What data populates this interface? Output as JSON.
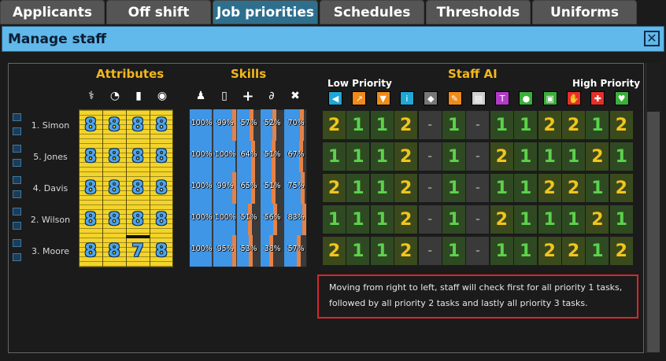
{
  "tabs": [
    {
      "label": "Applicants",
      "active": false
    },
    {
      "label": "Off shift",
      "active": false
    },
    {
      "label": "Job priorities",
      "active": true
    },
    {
      "label": "Schedules",
      "active": false
    },
    {
      "label": "Thresholds",
      "active": false
    },
    {
      "label": "Uniforms",
      "active": false
    }
  ],
  "window": {
    "title": "Manage staff",
    "close": "✕"
  },
  "sections": {
    "attributes": "Attributes",
    "skills": "Skills",
    "staff_ai": "Staff AI"
  },
  "priority_labels": {
    "low": "Low Priority",
    "high": "High Priority"
  },
  "attribute_icons": [
    "bone-icon",
    "gauge-icon",
    "clipboard-icon",
    "eye-icon"
  ],
  "skill_icons": [
    "person-icon",
    "trash-icon",
    "cross-icon",
    "wrench-pipe-icon",
    "tools-icon"
  ],
  "ai_icons": [
    {
      "name": "megaphone-icon",
      "color": "#1fa7d6"
    },
    {
      "name": "wrench-orange-icon",
      "color": "#f08a1a"
    },
    {
      "name": "shield-orange-icon",
      "color": "#f08a1a"
    },
    {
      "name": "info-icon",
      "color": "#1fa7d6"
    },
    {
      "name": "eraser-icon",
      "color": "#777777"
    },
    {
      "name": "sweep-icon",
      "color": "#f08a1a"
    },
    {
      "name": "document-icon",
      "color": "#cfcfcf"
    },
    {
      "name": "tool-purple-icon",
      "color": "#b13bc6"
    },
    {
      "name": "pills-icon",
      "color": "#3cae3c"
    },
    {
      "name": "device-green-icon",
      "color": "#3cae3c"
    },
    {
      "name": "hand-red-icon",
      "color": "#e53028"
    },
    {
      "name": "syringe-red-icon",
      "color": "#e53028"
    },
    {
      "name": "heart-green-icon",
      "color": "#3cae3c"
    }
  ],
  "staff": [
    {
      "name": "1. Simon",
      "attributes": [
        "8",
        "8",
        "8",
        "8"
      ],
      "skills": [
        {
          "text": "100%",
          "value": 1.0
        },
        {
          "text": "99%",
          "value": 0.99
        },
        {
          "text": "57%",
          "value": 0.57
        },
        {
          "text": "52%",
          "value": 0.52
        },
        {
          "text": "70%",
          "value": 0.7
        }
      ],
      "ai": [
        "2",
        "1",
        "1",
        "2",
        "-",
        "1",
        "-",
        "1",
        "1",
        "2",
        "2",
        "1",
        "2"
      ]
    },
    {
      "name": "5. Jones",
      "attributes": [
        "8",
        "8",
        "8",
        "8"
      ],
      "skills": [
        {
          "text": "100%",
          "value": 1.0
        },
        {
          "text": "100%",
          "value": 1.0
        },
        {
          "text": "64%",
          "value": 0.64
        },
        {
          "text": "51%",
          "value": 0.51
        },
        {
          "text": "67%",
          "value": 0.67
        }
      ],
      "ai": [
        "1",
        "1",
        "1",
        "2",
        "-",
        "1",
        "-",
        "2",
        "1",
        "1",
        "1",
        "2",
        "1"
      ]
    },
    {
      "name": "4. Davis",
      "attributes": [
        "8",
        "8",
        "8",
        "8"
      ],
      "skills": [
        {
          "text": "100%",
          "value": 1.0
        },
        {
          "text": "99%",
          "value": 0.99
        },
        {
          "text": "65%",
          "value": 0.65
        },
        {
          "text": "51%",
          "value": 0.51
        },
        {
          "text": "75%",
          "value": 0.75
        }
      ],
      "ai": [
        "2",
        "1",
        "1",
        "2",
        "-",
        "1",
        "-",
        "1",
        "1",
        "2",
        "2",
        "1",
        "2"
      ]
    },
    {
      "name": "2. Wilson",
      "attributes": [
        "8",
        "8",
        "8",
        "8"
      ],
      "skills": [
        {
          "text": "100%",
          "value": 1.0
        },
        {
          "text": "100%",
          "value": 1.0
        },
        {
          "text": "51%",
          "value": 0.51
        },
        {
          "text": "56%",
          "value": 0.56
        },
        {
          "text": "83%",
          "value": 0.83
        }
      ],
      "ai": [
        "1",
        "1",
        "1",
        "2",
        "-",
        "1",
        "-",
        "2",
        "1",
        "1",
        "1",
        "2",
        "1"
      ]
    },
    {
      "name": "3. Moore",
      "attributes": [
        "8",
        "8",
        "7",
        "8"
      ],
      "skills": [
        {
          "text": "100%",
          "value": 1.0
        },
        {
          "text": "95%",
          "value": 0.95
        },
        {
          "text": "53%",
          "value": 0.53
        },
        {
          "text": "38%",
          "value": 0.38
        },
        {
          "text": "57%",
          "value": 0.57
        }
      ],
      "ai": [
        "2",
        "1",
        "1",
        "2",
        "-",
        "1",
        "-",
        "1",
        "1",
        "2",
        "2",
        "1",
        "2"
      ]
    }
  ],
  "info_text": [
    "Moving from right to left, staff will check first for all priority 1 tasks,",
    "followed by all priority 2 tasks and lastly all priority 3 tasks."
  ]
}
